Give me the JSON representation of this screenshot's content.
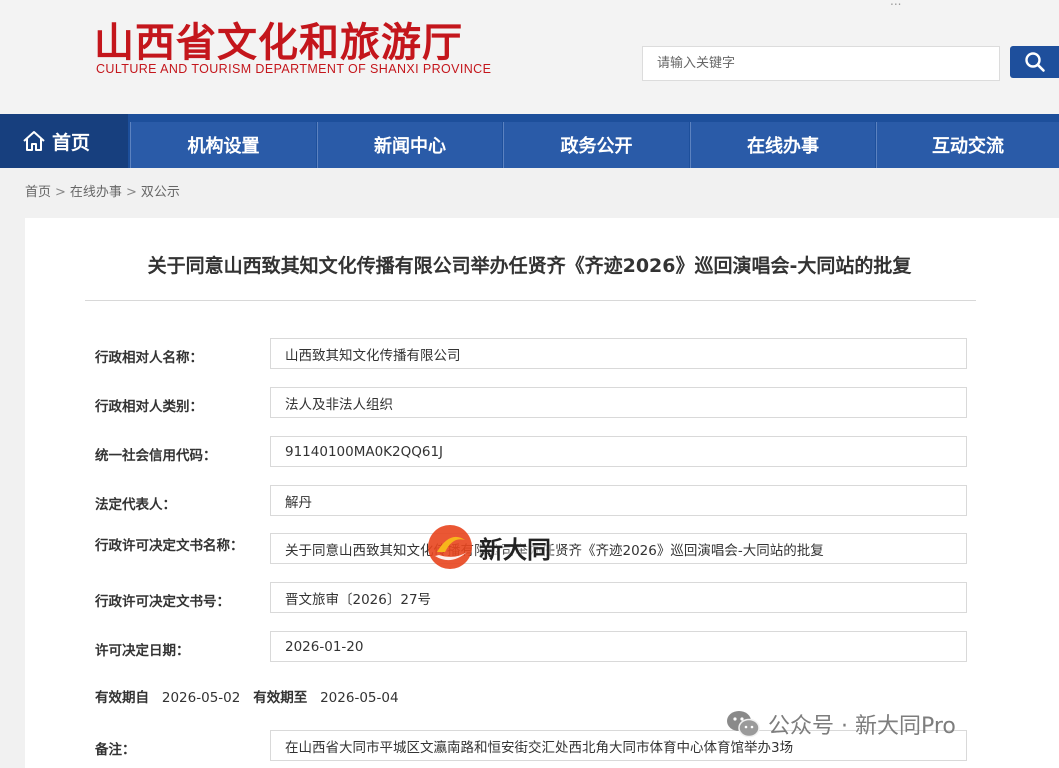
{
  "header": {
    "title_cn": "山西省文化和旅游厅",
    "title_en": "CULTURE AND TOURISM DEPARTMENT OF SHANXI PROVINCE",
    "topbar_partial": "...",
    "search": {
      "placeholder": "请输入关键字"
    }
  },
  "colors": {
    "brand_red": "#c4161c",
    "nav_blue": "#1d4f9b",
    "nav_dark": "#173f7e"
  },
  "nav": {
    "home_label": "首页",
    "items": [
      {
        "label": "机构设置"
      },
      {
        "label": "新闻中心"
      },
      {
        "label": "政务公开"
      },
      {
        "label": "在线办事"
      },
      {
        "label": "互动交流"
      }
    ]
  },
  "breadcrumb": [
    "首页",
    "在线办事",
    "双公示"
  ],
  "breadcrumb_sep": ">",
  "document": {
    "title": "关于同意山西致其知文化传播有限公司举办任贤齐《齐迹2026》巡回演唱会-大同站的批复",
    "fields": [
      {
        "label": "行政相对人名称：",
        "value": "山西致其知文化传播有限公司"
      },
      {
        "label": "行政相对人类别：",
        "value": "法人及非法人组织"
      },
      {
        "label": "统一社会信用代码：",
        "value": "91140100MA0K2QQ61J"
      },
      {
        "label": "法定代表人：",
        "value": "解丹"
      },
      {
        "label": "行政许可决定文书名称：",
        "value": "关于同意山西致其知文化传播有限公司举办任贤齐《齐迹2026》巡回演唱会-大同站的批复"
      },
      {
        "label": "行政许可决定文书号：",
        "value": "晋文旅审〔2026〕27号"
      },
      {
        "label": "许可决定日期：",
        "value": "2026-01-20"
      }
    ],
    "validity": {
      "from_label": "有效期自",
      "from_value": "2026-05-02",
      "to_label": "有效期至",
      "to_value": "2026-05-04"
    },
    "remark": {
      "label": "备注：",
      "value": "在山西省大同市平城区文瀛南路和恒安街交汇处西北角大同市体育中心体育馆举办3场"
    }
  },
  "watermarks": {
    "center_text": "新大同",
    "corner_text": "公众号 · 新大同Pro"
  }
}
